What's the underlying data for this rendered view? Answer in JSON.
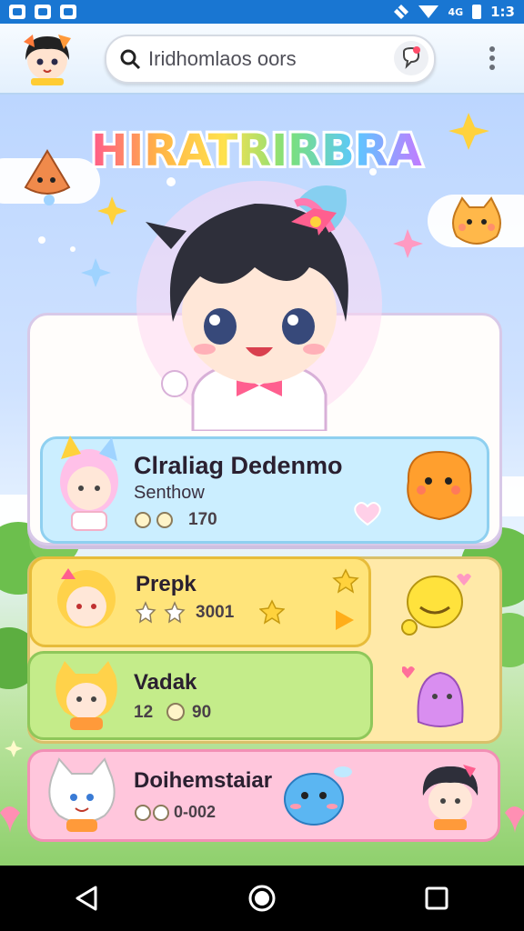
{
  "status_bar": {
    "time": "1:3",
    "signal_label": "4G"
  },
  "header": {
    "search_placeholder": "Iridhomlaos oors"
  },
  "game_title": "HIRATRIRBRA",
  "featured_card": {
    "title": "Clraliag Dedenmo",
    "subtitle": "Senthow",
    "stat": "170"
  },
  "cards": [
    {
      "title": "Prepk",
      "stat": "3001",
      "color": "#ffe98a"
    },
    {
      "title": "Vadak",
      "stat_a": "12",
      "stat_b": "90",
      "color": "#bfe98a"
    },
    {
      "title": "Doihemstaiar",
      "stat": "0-002",
      "color": "#ffc6dc"
    }
  ],
  "colors": {
    "status_bar": "#1976d2",
    "accent_pink": "#ff6fa8",
    "star_yellow": "#ffd23c"
  }
}
